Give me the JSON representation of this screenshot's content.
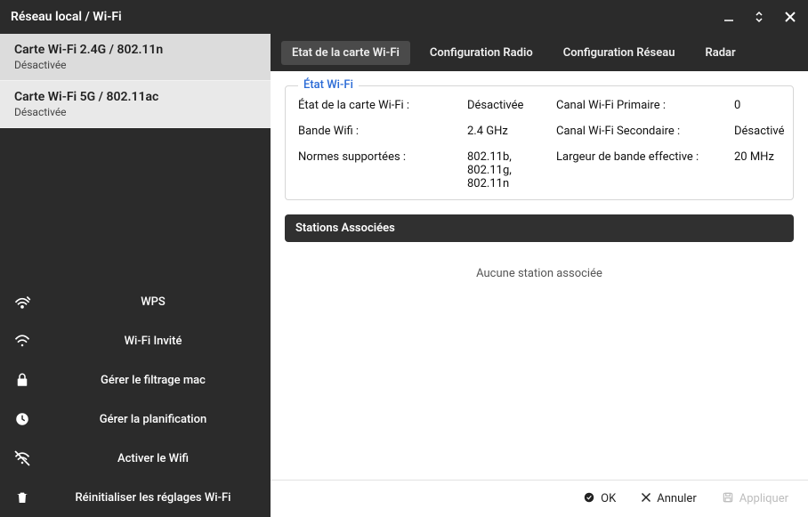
{
  "window": {
    "title": "Réseau local / Wi-Fi"
  },
  "sidebar": {
    "cards": [
      {
        "title": "Carte Wi-Fi 2.4G / 802.11n",
        "sub": "Désactivée",
        "active": true
      },
      {
        "title": "Carte Wi-Fi 5G / 802.11ac",
        "sub": "Désactivée",
        "active": false
      }
    ],
    "actions": [
      {
        "label": "WPS"
      },
      {
        "label": "Wi-Fi Invité"
      },
      {
        "label": "Gérer le filtrage mac"
      },
      {
        "label": "Gérer la planification"
      },
      {
        "label": "Activer le Wifi"
      },
      {
        "label": "Réinitialiser les réglages Wi-Fi"
      }
    ]
  },
  "tabs": [
    {
      "label": "Etat de la carte Wi-Fi",
      "active": true
    },
    {
      "label": "Configuration Radio",
      "active": false
    },
    {
      "label": "Configuration Réseau",
      "active": false
    },
    {
      "label": "Radar",
      "active": false
    }
  ],
  "status": {
    "legend": "État Wi-Fi",
    "row1": {
      "k1": "État de la carte Wi-Fi :",
      "v1": "Désactivée",
      "k2": "Canal Wi-Fi Primaire :",
      "v2": "0"
    },
    "row2": {
      "k1": "Bande Wifi :",
      "v1": "2.4 GHz",
      "k2": "Canal Wi-Fi Secondaire :",
      "v2": "Désactivé"
    },
    "row3": {
      "k1": "Normes supportées :",
      "v1": "802.11b, 802.11g, 802.11n",
      "k2": "Largeur de bande effective :",
      "v2": "20 MHz"
    }
  },
  "associated": {
    "title": "Stations Associées",
    "empty": "Aucune station associée"
  },
  "footer": {
    "ok": "OK",
    "cancel": "Annuler",
    "apply": "Appliquer"
  }
}
